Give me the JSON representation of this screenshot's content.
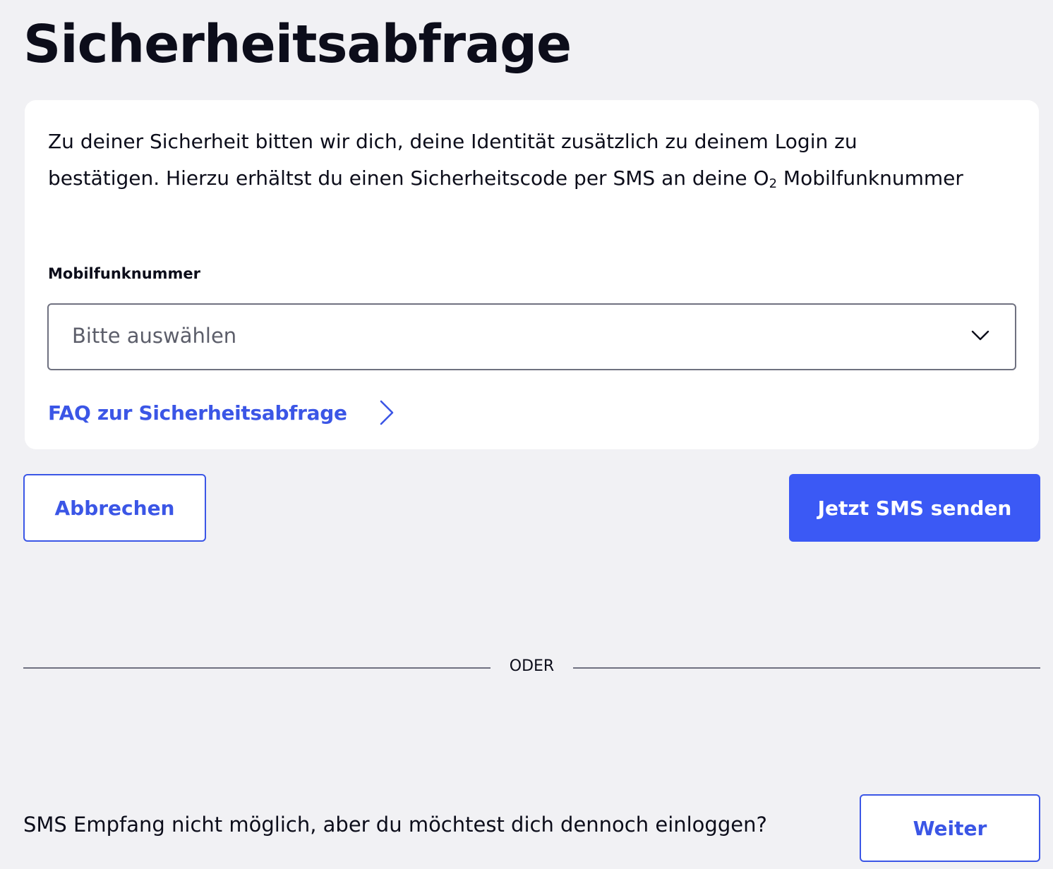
{
  "page": {
    "title": "Sicherheitsabfrage"
  },
  "card": {
    "intro_main": "Zu deiner Sicherheit bitten wir dich, deine Identität zusätzlich zu deinem Login zu bestätigen. Hierzu erhältst du einen Sicherheitscode per SMS an deine O",
    "intro_sub": "2",
    "intro_end": " Mobilfunknummer",
    "field_label": "Mobilfunknummer",
    "select_placeholder": "Bitte auswählen",
    "faq_link": "FAQ zur Sicherheitsabfrage"
  },
  "actions": {
    "cancel_label": "Abbrechen",
    "send_label": "Jetzt SMS senden"
  },
  "divider": {
    "label": "ODER"
  },
  "fallback": {
    "text": "SMS Empfang nicht möglich, aber du möchtest dich dennoch einloggen?",
    "button_label": "Weiter"
  },
  "icons": {
    "select_chevron": "chevron-down-icon",
    "faq_chevron": "chevron-right-icon"
  },
  "colors": {
    "accent": "#3b56e6",
    "primary_button": "#3b59f5",
    "background": "#f1f1f4",
    "text": "#0c0d1a"
  }
}
